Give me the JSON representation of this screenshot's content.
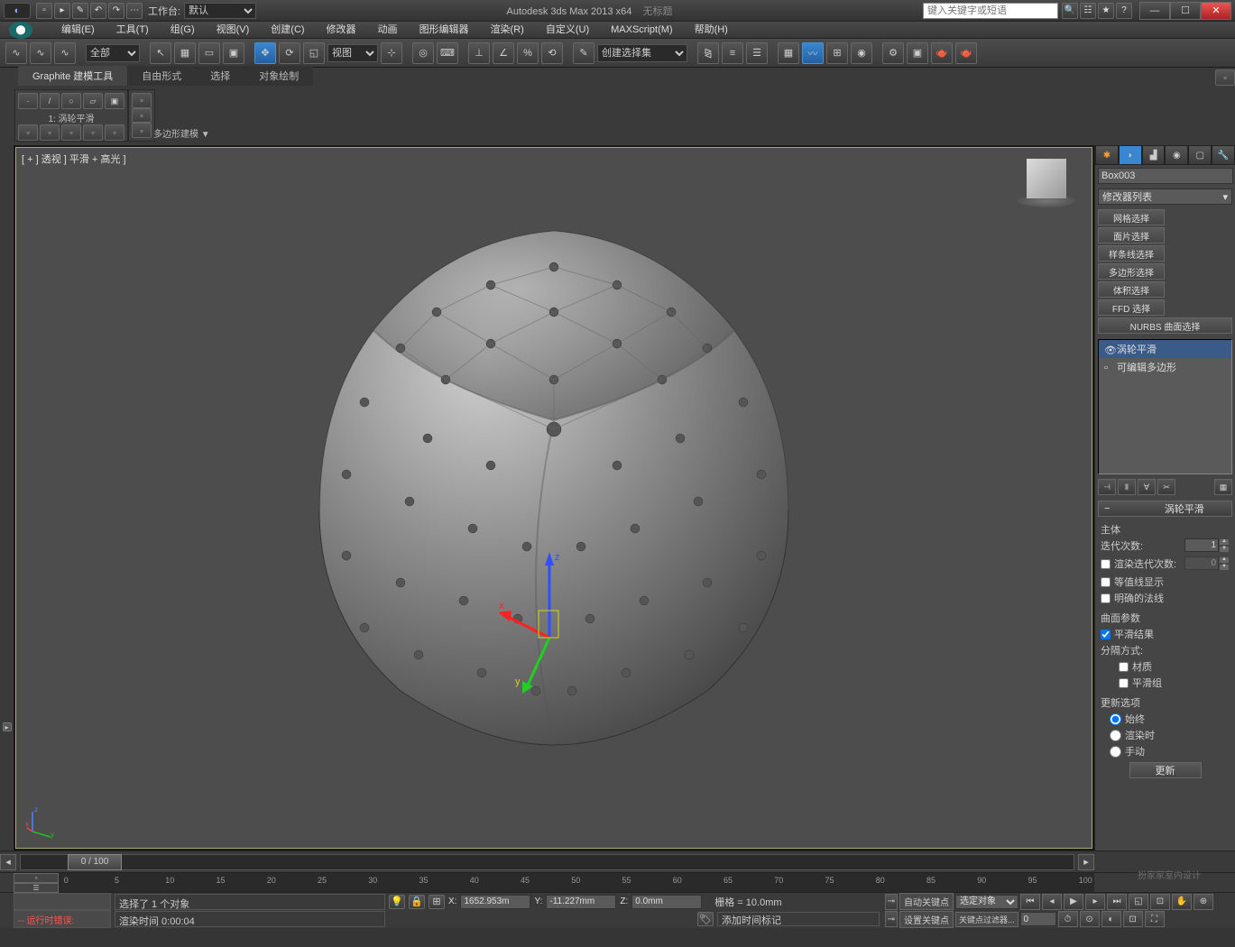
{
  "title": {
    "app": "Autodesk 3ds Max  2013 x64",
    "doc": "无标题",
    "workspace_label": "工作台:",
    "workspace_value": "默认",
    "search_placeholder": "键入关键字或短语"
  },
  "menus": [
    "编辑(E)",
    "工具(T)",
    "组(G)",
    "视图(V)",
    "创建(C)",
    "修改器",
    "动画",
    "图形编辑器",
    "渲染(R)",
    "自定义(U)",
    "MAXScript(M)",
    "帮助(H)"
  ],
  "toolbar": {
    "filter_label": "全部",
    "ref_coord": "视图",
    "named_sel": "创建选择集"
  },
  "ribbon": {
    "tabs": [
      "Graphite 建模工具",
      "自由形式",
      "选择",
      "对象绘制"
    ],
    "group1_title": "1: 涡轮平滑",
    "dropdown": "多边形建模 ▼"
  },
  "viewport": {
    "label": "[ + ] 透视 ] 平滑 + 高光 ]"
  },
  "command_panel": {
    "object_name": "Box003",
    "mod_list_label": "修改器列表",
    "sel_buttons": [
      "网格选择",
      "面片选择",
      "样条线选择",
      "多边形选择",
      "体积选择",
      "FFD 选择"
    ],
    "nurbs_btn": "NURBS 曲面选择",
    "stack": [
      "涡轮平滑",
      "可编辑多边形"
    ],
    "rollout_title": "涡轮平滑",
    "main_group": "主体",
    "iterations_label": "迭代次数:",
    "iterations_value": "1",
    "render_iter_label": "渲染迭代次数:",
    "render_iter_value": "0",
    "isoline_label": "等值线显示",
    "explicit_label": "明确的法线",
    "surface_params": "曲面参数",
    "smooth_result": "平滑结果",
    "sep_by": "分隔方式:",
    "sep_mat": "材质",
    "sep_smg": "平滑组",
    "update_opts": "更新选项",
    "upd_always": "始终",
    "upd_render": "渲染时",
    "upd_manual": "手动",
    "update_btn": "更新"
  },
  "timeline": {
    "slider": "0 / 100",
    "ticks": [
      0,
      5,
      10,
      15,
      20,
      25,
      30,
      35,
      40,
      45,
      50,
      55,
      60,
      65,
      70,
      75,
      80,
      85,
      90,
      95,
      100
    ]
  },
  "status": {
    "selected": "选择了 1 个对象",
    "runtime_err": "-- 运行时错误:",
    "render_time": "渲染时间  0:00:04",
    "x_label": "X:",
    "x_val": "1652.953m",
    "y_label": "Y:",
    "y_val": "-11.227mm",
    "z_label": "Z:",
    "z_val": "0.0mm",
    "grid": "栅格 = 10.0mm",
    "add_time_tag": "添加时间标记",
    "auto_key": "自动关键点",
    "set_key": "设置关键点",
    "sel_obj": "选定对象",
    "key_filter": "关键点过滤器..."
  }
}
